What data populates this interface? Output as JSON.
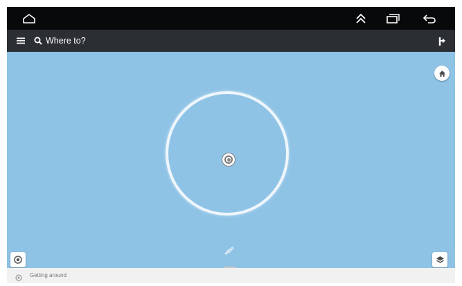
{
  "system_bar": {
    "icons": [
      "home-outline-icon",
      "chevron-double-up-icon",
      "recent-apps-icon",
      "back-arrow-icon"
    ]
  },
  "app_bar": {
    "menu_icon": "hamburger-menu-icon",
    "search_icon": "search-icon",
    "search_placeholder": "Where to?",
    "directions_icon": "directions-icon"
  },
  "map": {
    "background_color": "#8fc3e6",
    "home_button_icon": "home-icon",
    "locate_button_icon": "my-location-icon",
    "layers_button_icon": "layers-icon",
    "gps_icon": "satellite-icon"
  },
  "bottom_sheet": {
    "label": "Getting around",
    "icon": "compass-icon"
  }
}
